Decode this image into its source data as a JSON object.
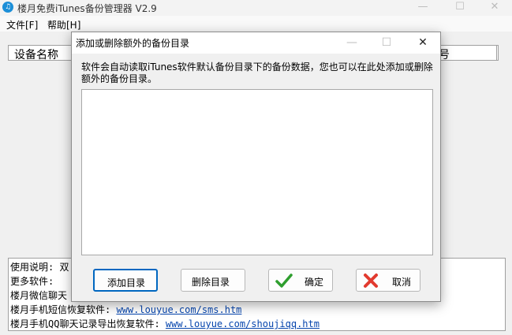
{
  "app": {
    "title": "楼月免费iTunes备份管理器 V2.9",
    "icon_glyph": "♫",
    "menus": [
      {
        "label": "文件[F]"
      },
      {
        "label": "帮助[H]"
      }
    ]
  },
  "device_table": {
    "columns": [
      "设备名称",
      "号"
    ]
  },
  "info_panel": {
    "lines": [
      {
        "text": "使用说明: 双"
      },
      {
        "text": "更多软件:"
      },
      {
        "text": "楼月微信聊天"
      },
      {
        "text": "楼月手机短信恢复软件: ",
        "link": "www.louyue.com/sms.htm"
      },
      {
        "text": "楼月手机QQ聊天记录导出恢复软件: ",
        "link": "www.louyue.com/shoujiqq.htm"
      }
    ]
  },
  "dialog": {
    "title": "添加或删除额外的备份目录",
    "description": "软件会自动读取iTunes软件默认备份目录下的备份数据，您也可以在此处添加或删除额外的备份目录。",
    "buttons": {
      "add": "添加目录",
      "remove": "删除目录",
      "ok": "确定",
      "cancel": "取消"
    }
  },
  "window_controls": {
    "minimize": "—",
    "maximize": "☐",
    "close": "✕"
  },
  "colors": {
    "accent": "#0067c0",
    "ok_icon": "#2e9e2e",
    "cancel_icon": "#e23a2f",
    "link": "#0645ad"
  },
  "icons": [
    "music-note-icon",
    "checkmark-icon",
    "cross-icon"
  ]
}
